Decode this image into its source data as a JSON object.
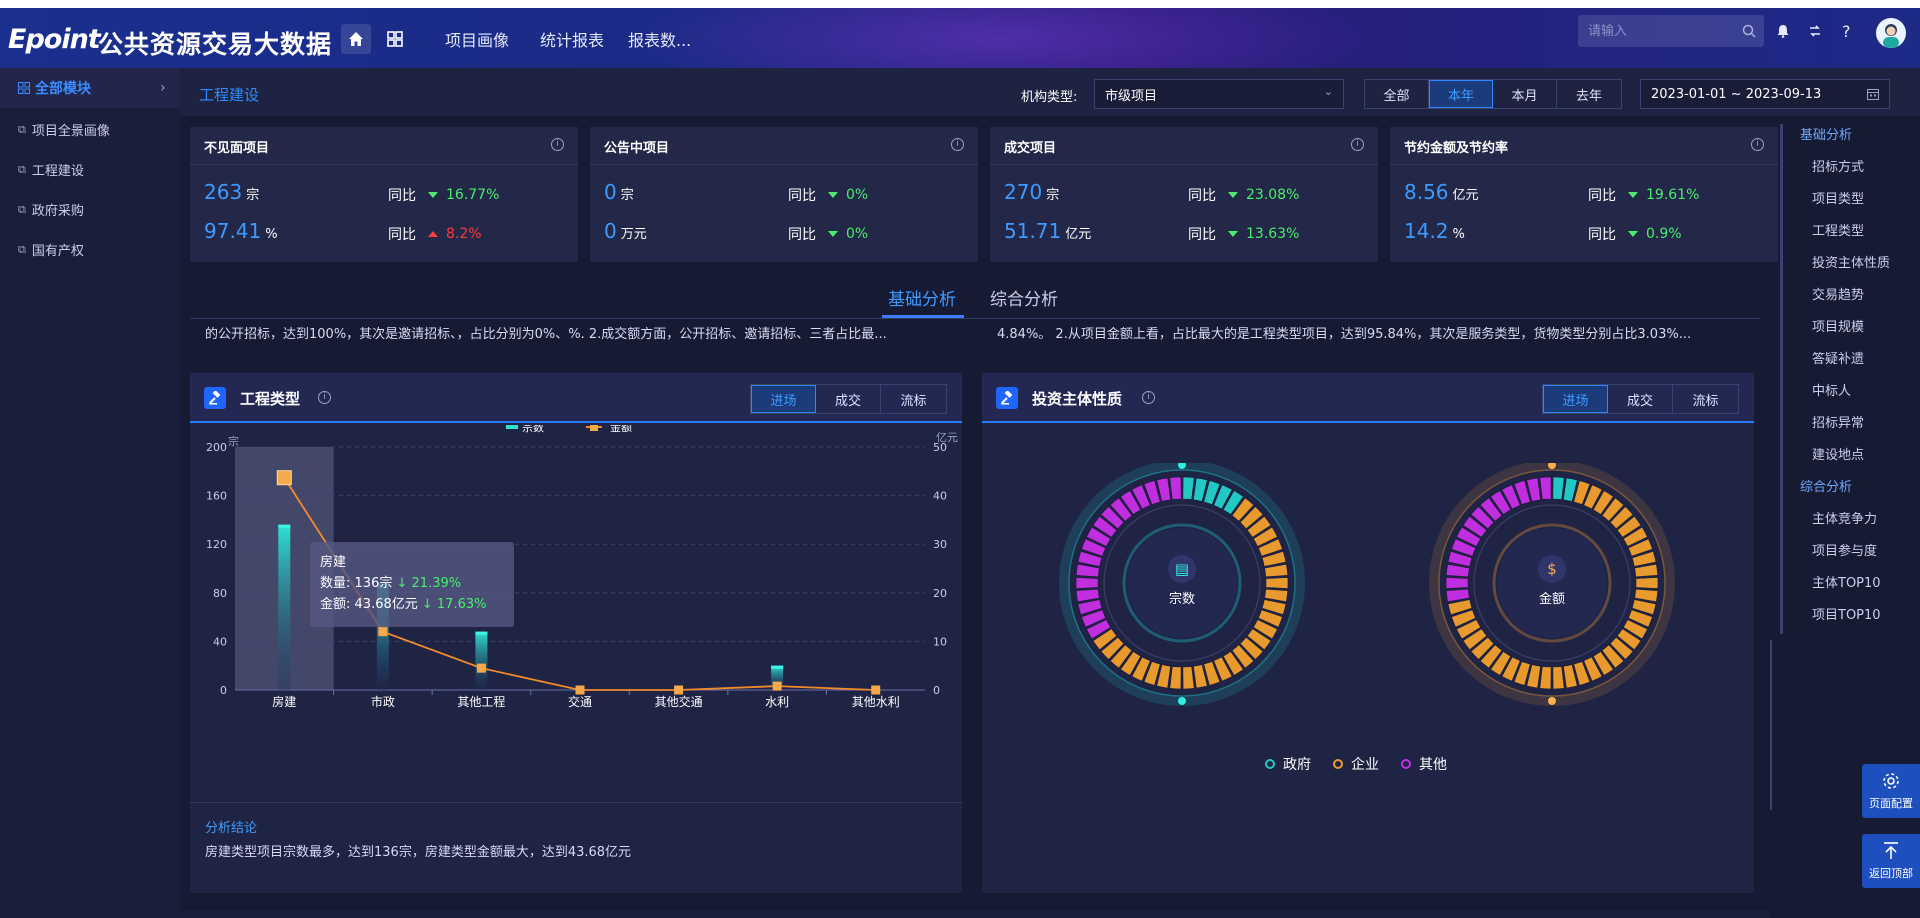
{
  "header": {
    "logo": "Epoint",
    "title": "公共资源交易大数据",
    "nav": [
      "项目画像",
      "统计报表",
      "报表数..."
    ],
    "search_placeholder": "请输入"
  },
  "sidebar": {
    "all_label": "全部模块",
    "items": [
      "项目全景画像",
      "工程建设",
      "政府采购",
      "国有产权"
    ]
  },
  "breadcrumb": "工程建设",
  "filters": {
    "org_type_label": "机构类型:",
    "org_type_value": "市级项目",
    "periods": [
      "全部",
      "本年",
      "本月",
      "去年"
    ],
    "active_period": "本年",
    "date_range": "2023-01-01 ~ 2023-09-13"
  },
  "cards": [
    {
      "title": "不见面项目",
      "m1": "263",
      "u1": "宗",
      "yoy1": "16.77%",
      "m2": "97.41",
      "u2": "%",
      "yoy2": "8.2%",
      "yoy_label": "同比"
    },
    {
      "title": "公告中项目",
      "m1": "0",
      "u1": "宗",
      "yoy1": "0%",
      "m2": "0",
      "u2": "万元",
      "yoy2": "0%",
      "yoy_label": "同比"
    },
    {
      "title": "成交项目",
      "m1": "270",
      "u1": "宗",
      "yoy1": "23.08%",
      "m2": "51.71",
      "u2": "亿元",
      "yoy2": "13.63%",
      "yoy_label": "同比"
    },
    {
      "title": "节约金额及节约率",
      "m1": "8.56",
      "u1": "亿元",
      "yoy1": "19.61%",
      "m2": "14.2",
      "u2": "%",
      "yoy2": "0.9%",
      "yoy_label": "同比"
    }
  ],
  "tabs": {
    "basic": "基础分析",
    "composite": "综合分析"
  },
  "summaries": {
    "left": "的公开招标，达到100%，其次是邀请招标、，占比分别为0%、%. 2.成交额方面，公开招标、邀请招标、三者占比最...",
    "right": "4.84%。 2.从项目金额上看，占比最大的是工程类型项目，达到95.84%，其次是服务类型，货物类型分别占比3.03%..."
  },
  "panel_left": {
    "title": "工程类型",
    "toggles": [
      "进场",
      "成交",
      "流标"
    ],
    "tooltip": {
      "title": "房建",
      "count_label": "数量:",
      "count": "136宗",
      "count_yoy": "↓ 21.39%",
      "amount_label": "金额:",
      "amount": "43.68亿元",
      "amount_yoy": "↓ 17.63%"
    },
    "analysis_title": "分析结论",
    "analysis_text": "房建类型项目宗数最多，达到136宗，房建类型金额最大，达到43.68亿元"
  },
  "chart_data": [
    {
      "type": "bar",
      "legend": [
        "宗数",
        "金额"
      ],
      "categories": [
        "房建",
        "市政",
        "其他工程",
        "交通",
        "其他交通",
        "水利",
        "其他水利"
      ],
      "series": [
        {
          "name": "宗数",
          "type": "bar",
          "axis": "left",
          "values": [
            136,
            88,
            48,
            0,
            0,
            20,
            0
          ]
        },
        {
          "name": "金额",
          "type": "line",
          "axis": "right",
          "values": [
            43.68,
            12,
            4.5,
            0,
            0,
            0.8,
            0
          ]
        }
      ],
      "yleft": {
        "label": "宗",
        "ylim": [
          0,
          200
        ],
        "ticks": [
          0,
          40,
          80,
          120,
          160,
          200
        ]
      },
      "yright": {
        "label": "亿元",
        "ylim": [
          0,
          50
        ],
        "ticks": [
          0,
          10,
          20,
          30,
          40,
          50
        ]
      },
      "highlight": "房建",
      "grid": true,
      "legend_position": "top-center"
    },
    {
      "type": "pie",
      "title": "宗数",
      "categories": [
        "政府",
        "企业",
        "其他"
      ],
      "values": [
        9,
        57,
        34
      ]
    },
    {
      "type": "pie",
      "title": "金额",
      "categories": [
        "政府",
        "企业",
        "其他"
      ],
      "values": [
        3,
        69,
        28
      ]
    }
  ],
  "panel_right": {
    "title": "投资主体性质",
    "toggles": [
      "进场",
      "成交",
      "流标"
    ],
    "legend": [
      "政府",
      "企业",
      "其他"
    ]
  },
  "colors": {
    "gov": "#22c9c4",
    "ent": "#e89a2e",
    "other": "#c12ee0",
    "accent": "#2f86ff",
    "line": "#f08a2c"
  },
  "rightnav": {
    "sections": [
      {
        "heading": "基础分析",
        "items": [
          "招标方式",
          "项目类型",
          "工程类型",
          "投资主体性质",
          "交易趋势",
          "项目规模",
          "答疑补遗",
          "中标人",
          "招标异常",
          "建设地点"
        ]
      },
      {
        "heading": "综合分析",
        "items": [
          "主体竞争力",
          "项目参与度",
          "主体TOP10",
          "项目TOP10"
        ]
      }
    ]
  },
  "float_buttons": [
    "页面配置",
    "返回顶部"
  ]
}
